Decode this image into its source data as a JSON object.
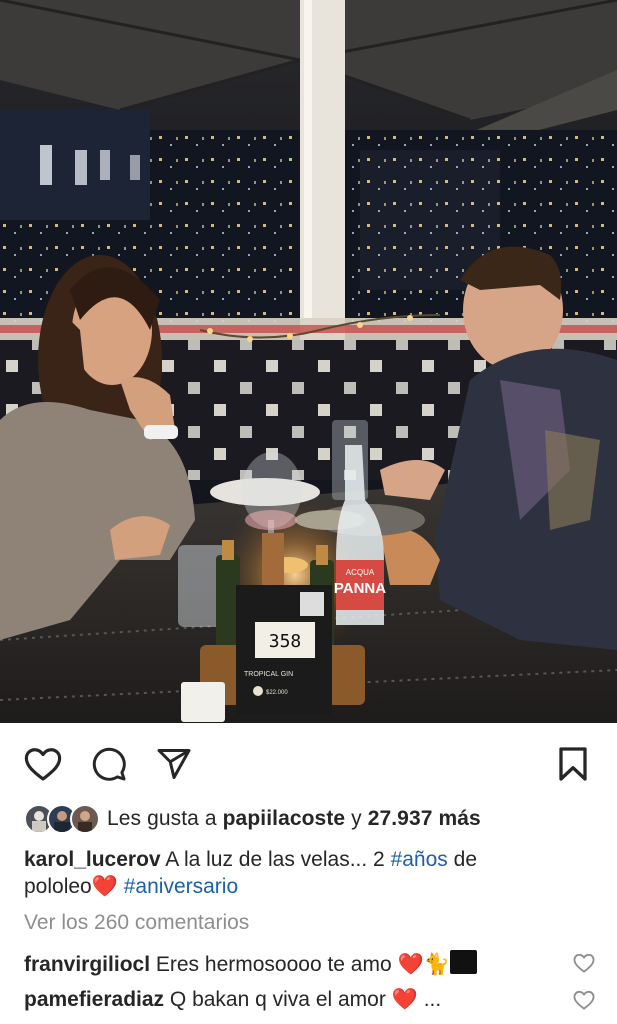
{
  "post": {
    "actions": {
      "like_icon": "heart-outline",
      "comment_icon": "speech-bubble",
      "share_icon": "paper-plane",
      "save_icon": "bookmark"
    },
    "likes": {
      "prefix": "Les gusta a",
      "user": "papiilacoste",
      "connector": "y",
      "count": "27.937 más"
    },
    "caption": {
      "username": "karol_lucerov",
      "text1": "A la luz de las velas... 2",
      "tag1": "#años",
      "text2": "de",
      "text3": "pololeo",
      "emoji": "❤️",
      "tag2": "#aniversario"
    },
    "view_comments": "Ver los 260 comentarios",
    "comments": [
      {
        "username": "franvirgiliocl",
        "text": "Eres hermosoooo te amo",
        "emoji": "❤️",
        "emoji2": "🐈"
      },
      {
        "username": "pamefieradiaz",
        "text": "Q bakan q viva el amor",
        "emoji": "❤️",
        "tail": "..."
      }
    ],
    "photo_text": {
      "table_number": "358",
      "menu_title": "TROPICAL GIN",
      "menu_price": "$22.000",
      "bottle_brand": "PANNA",
      "bottle_top": "ACQUA"
    },
    "colors": {
      "link": "#1d5fa8",
      "muted": "#8e8e8e",
      "heart": "#e0232b"
    }
  }
}
